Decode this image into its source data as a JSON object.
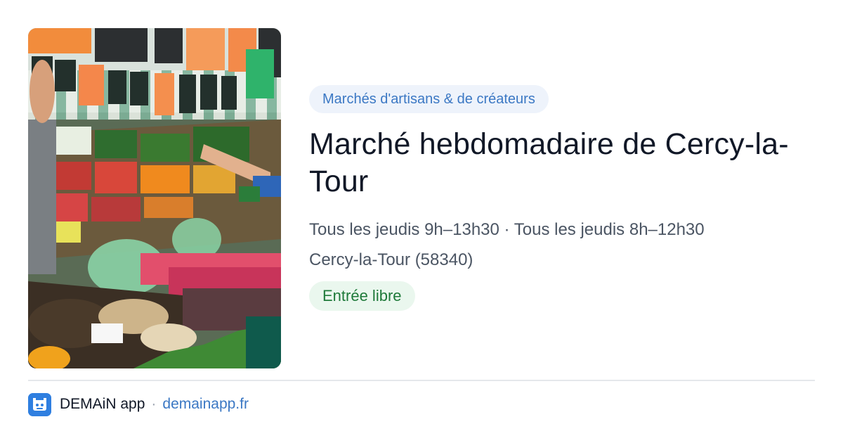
{
  "card": {
    "category": "Marchés d'artisans & de créateurs",
    "title": "Marché hebdomadaire de Cercy-la-Tour",
    "schedule": "Tous les jeudis 9h–13h30 · Tous les jeudis 8h–12h30",
    "location": "Cercy-la-Tour (58340)",
    "entry": "Entrée libre",
    "image_subject": "market stall with fruits, vegetables and mushrooms"
  },
  "footer": {
    "app_name": "DEMAiN app",
    "separator": "·",
    "domain": "demainapp.fr",
    "icon": "demain-app-icon"
  },
  "colors": {
    "category_text": "#3b78c4",
    "category_bg": "#eef3fb",
    "entry_text": "#1f7a3a",
    "entry_bg": "#eaf7ee",
    "link": "#3b78c4",
    "app_icon_bg": "#2f7fe0"
  }
}
